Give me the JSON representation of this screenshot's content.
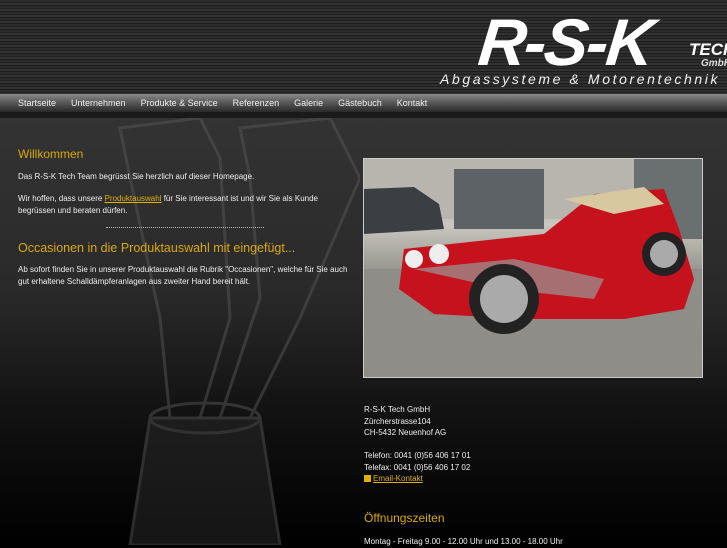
{
  "logo": {
    "main": "R-S-K",
    "tech": "TECH",
    "gmbh": "GmbH",
    "tagline": "Abgassysteme & Motorentechnik"
  },
  "nav": [
    "Startseite",
    "Unternehmen",
    "Produkte & Service",
    "Referenzen",
    "Galerie",
    "Gästebuch",
    "Kontakt"
  ],
  "welcome": {
    "title": "Willkommen",
    "p1": "Das R-S-K Tech Team begrüsst Sie herzlich auf dieser Homepage.",
    "p2_before": "Wir hoffen, dass unsere ",
    "p2_link": "Produktauswahl",
    "p2_after": " für Sie interessant ist und wir Sie als Kunde begrüssen und beraten dürfen."
  },
  "news": {
    "title": "Occasionen in die Produktauswahl mit eingefügt...",
    "text": "Ab sofort finden Sie in unserer Produktauswahl die Rubrik \"Occasionen\", welche für Sie auch gut erhaltene Schalldämpferanlagen aus zweiter Hand bereit hält."
  },
  "contact": {
    "company": "R-S-K Tech GmbH",
    "street": "Zürcherstrasse104",
    "city": "CH-5432 Neuenhof AG",
    "phone": "Telefon: 0041 (0)56 406 17 01",
    "fax": "Telefax: 0041 (0)56 406 17 02",
    "email": "Email-Kontakt"
  },
  "hours": {
    "title": "Öffnungszeiten",
    "text": "Montag - Freitag 9.00 - 12.00 Uhr und 13.00 - 18.00 Uhr"
  },
  "colors": {
    "accent": "#d9a900"
  }
}
